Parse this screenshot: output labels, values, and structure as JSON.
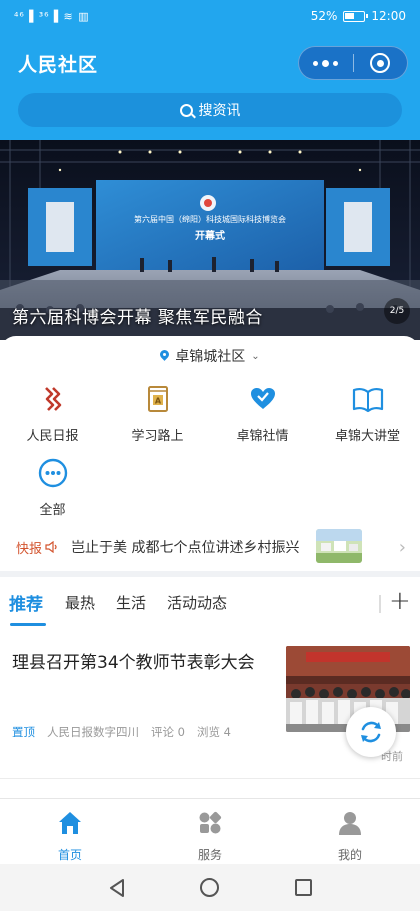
{
  "status_bar": {
    "signal_text": "⁴⁶▐ ³⁶▐ ≋ ▥",
    "battery_percent": "52%",
    "time": "12:00"
  },
  "header": {
    "title": "人民社区",
    "more_icon": "more-dots-icon",
    "close_icon": "target-icon"
  },
  "search": {
    "placeholder": "搜资讯"
  },
  "banner": {
    "caption": "第六届科博会开幕 聚焦军民融合",
    "indicator": "2/5",
    "screen_title": "第六届中国（绵阳）科技城国际科技博览会",
    "screen_subtitle": "开幕式"
  },
  "community": {
    "name": "卓锦城社区"
  },
  "quick_links": [
    {
      "label": "人民日报",
      "icon": "people-daily-icon",
      "color": "#c0392b"
    },
    {
      "label": "学习路上",
      "icon": "book-badge-icon",
      "color": "#b8893a"
    },
    {
      "label": "卓锦社情",
      "icon": "heart-icon",
      "color": "#1f8fe0"
    },
    {
      "label": "卓锦大讲堂",
      "icon": "open-book-icon",
      "color": "#1f8fe0"
    },
    {
      "label": "全部",
      "icon": "more-circle-icon",
      "color": "#1f8fe0"
    }
  ],
  "ticker": {
    "tag": "快报",
    "text": "岂止于美 成都七个点位讲述乡村振兴..."
  },
  "tabs": {
    "items": [
      "推荐",
      "最热",
      "生活",
      "活动动态"
    ],
    "active_index": 0,
    "add_label": "+"
  },
  "article": {
    "headline": "理县召开第34个教师节表彰大会",
    "tag": "置顶",
    "source": "人民日报数字四川",
    "comments": "评论 0",
    "views": "浏览 4",
    "time": "时前"
  },
  "bottom_nav": {
    "items": [
      {
        "label": "首页",
        "icon": "home-icon",
        "active": true
      },
      {
        "label": "服务",
        "icon": "services-icon",
        "active": false
      },
      {
        "label": "我的",
        "icon": "profile-icon",
        "active": false
      }
    ]
  },
  "colors": {
    "brand": "#22a6ee",
    "accent": "#1f8fe0",
    "alert": "#d3542e"
  }
}
